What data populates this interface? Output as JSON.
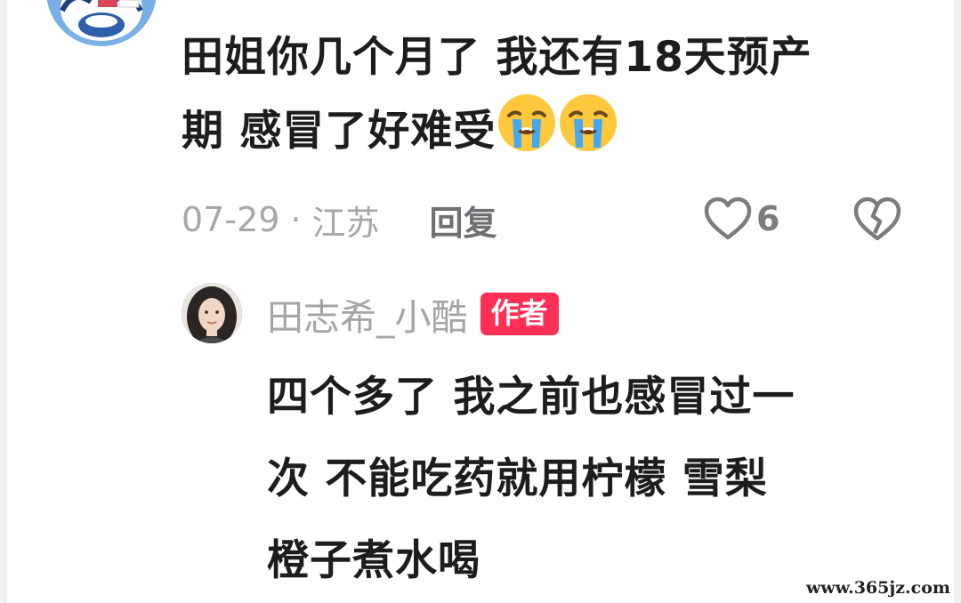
{
  "comment": {
    "lines": [
      "田姐你几个月了 我还有18天预产",
      "期 感冒了好难受"
    ],
    "emojis": [
      "crying-face-emoji",
      "crying-face-emoji"
    ],
    "date": "07-29",
    "separator": "·",
    "location": "江苏",
    "reply_label": "回复",
    "like_count": "6"
  },
  "reply": {
    "author": "田志希_小酷",
    "badge": "作者",
    "lines": [
      "四个多了 我之前也感冒过一",
      "次 不能吃药就用柠檬 雪梨",
      "橙子煮水喝"
    ]
  },
  "watermark": "www.365jz.com",
  "colors": {
    "badge_bg": "#ff2f55",
    "meta_text": "#a6a6ab",
    "body_text": "#1d1d1f"
  }
}
